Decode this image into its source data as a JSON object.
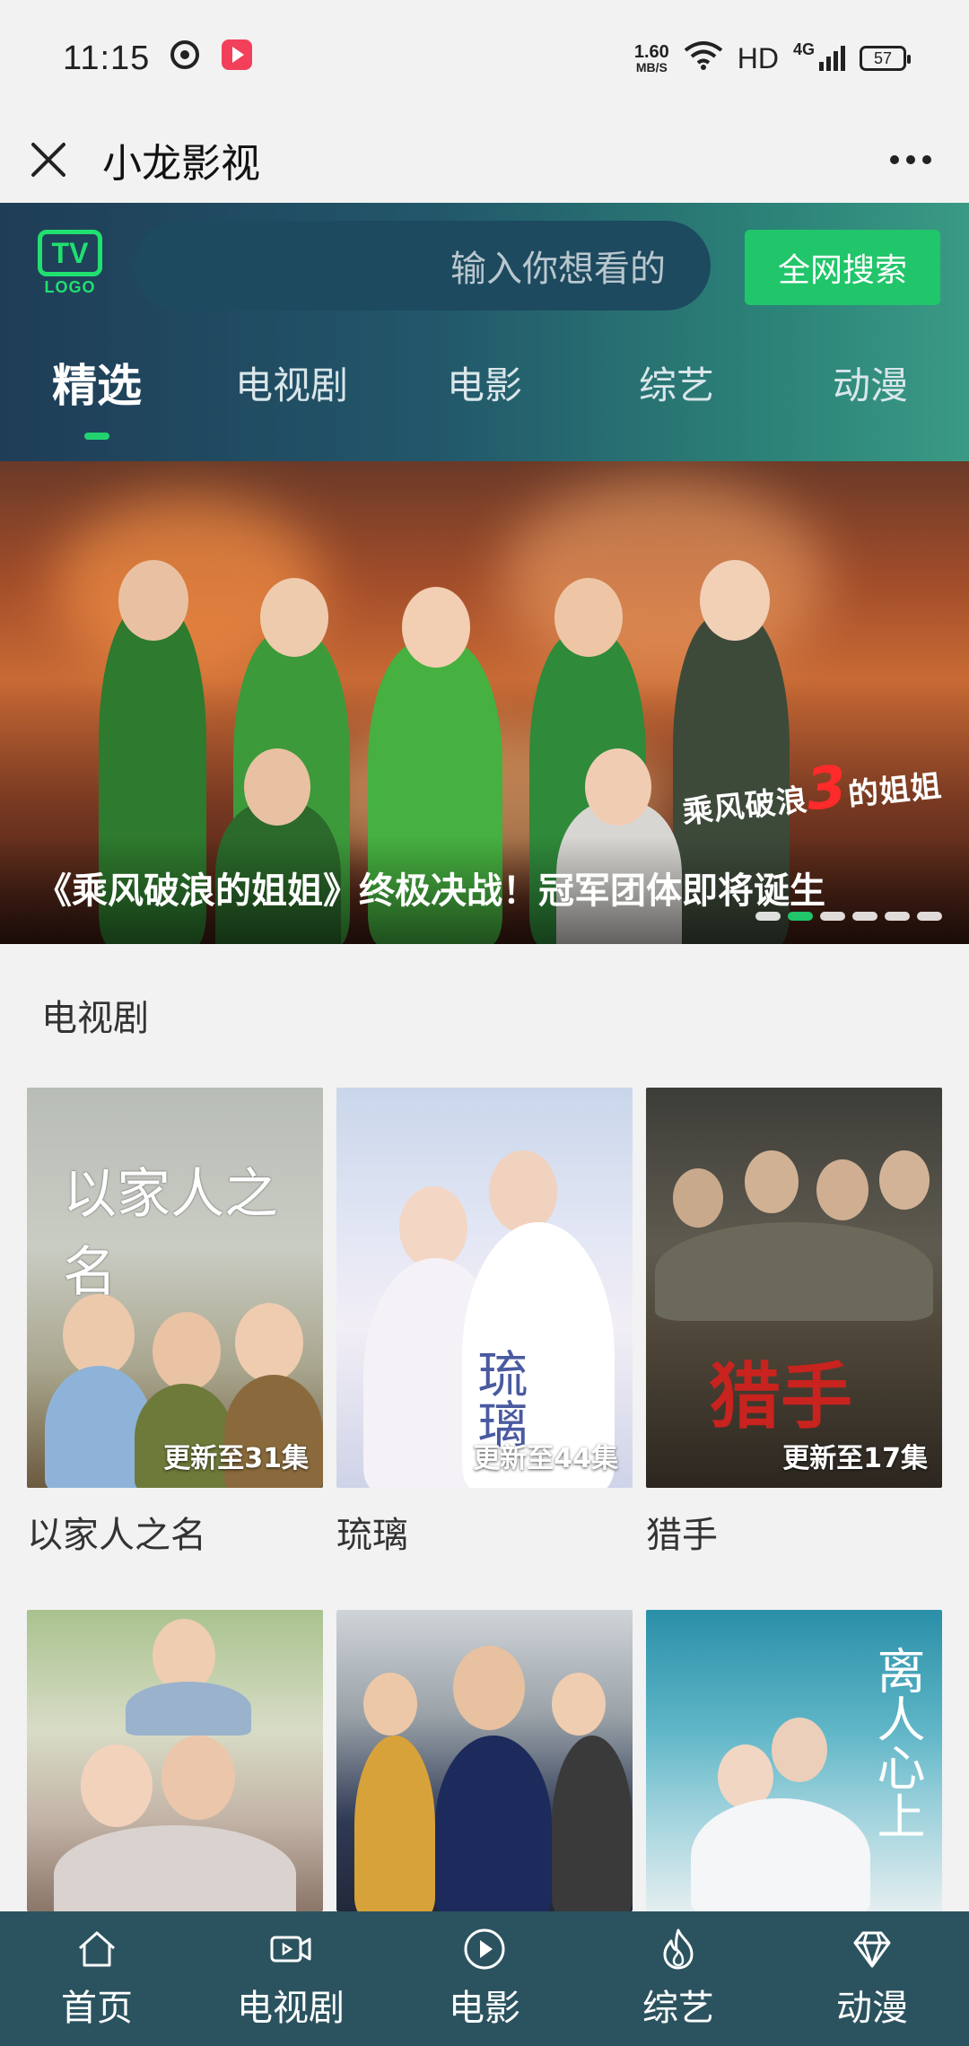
{
  "status_bar": {
    "time": "11:15",
    "net_speed_value": "1.60",
    "net_speed_unit": "MB/S",
    "hd": "HD",
    "network": "4G",
    "battery": "57"
  },
  "title_bar": {
    "title": "小龙影视"
  },
  "header": {
    "logo_mark": "TV",
    "logo_text": "LOGO",
    "search_placeholder": "输入你想看的",
    "search_button": "全网搜索",
    "tabs": [
      {
        "label": "精选",
        "active": true
      },
      {
        "label": "电视剧",
        "active": false
      },
      {
        "label": "电影",
        "active": false
      },
      {
        "label": "综艺",
        "active": false
      },
      {
        "label": "动漫",
        "active": false
      }
    ]
  },
  "banner": {
    "caption": "《乘风破浪的姐姐》终极决战！冠军团体即将诞生",
    "show_logo_prefix": "乘风破浪",
    "show_logo_number": "3",
    "show_logo_suffix": "的姐姐",
    "slide_count": 6,
    "active_slide": 2
  },
  "section": {
    "title": "电视剧",
    "items": [
      {
        "title": "以家人之名",
        "badge": "更新至31集",
        "poster_text": "以家人之名"
      },
      {
        "title": "琉璃",
        "badge": "更新至44集",
        "poster_text": "琉璃"
      },
      {
        "title": "猎手",
        "badge": "更新至17集",
        "poster_text": "猎手"
      },
      {
        "title": "",
        "badge": "",
        "poster_text": ""
      },
      {
        "title": "",
        "badge": "",
        "poster_text": ""
      },
      {
        "title": "",
        "badge": "",
        "poster_text": "离人心上"
      }
    ]
  },
  "bottom_nav": [
    {
      "label": "首页",
      "icon": "home-icon"
    },
    {
      "label": "电视剧",
      "icon": "video-camera-icon"
    },
    {
      "label": "电影",
      "icon": "play-circle-icon"
    },
    {
      "label": "综艺",
      "icon": "flame-icon"
    },
    {
      "label": "动漫",
      "icon": "diamond-icon"
    }
  ],
  "colors": {
    "accent": "#21c56a",
    "header_start": "#1f3d57",
    "header_end": "#3a9a85",
    "bottom_nav": "#2b535f"
  }
}
